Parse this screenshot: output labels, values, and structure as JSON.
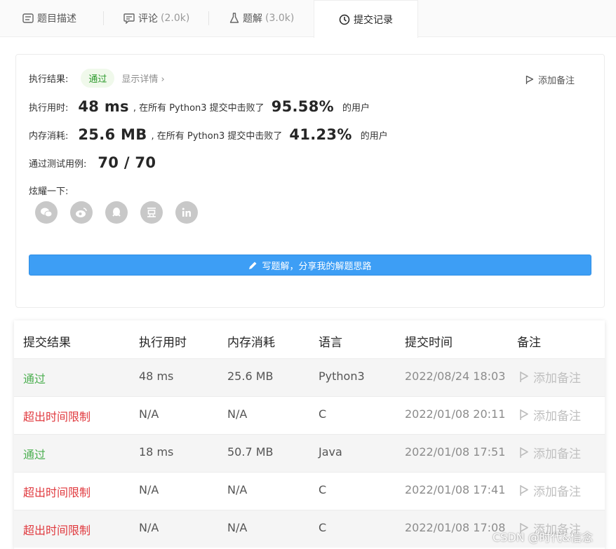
{
  "tabs": [
    {
      "label": "题目描述",
      "count": "",
      "icon": "description-icon"
    },
    {
      "label": "评论",
      "count": "(2.0k)",
      "icon": "comment-icon"
    },
    {
      "label": "题解",
      "count": "(3.0k)",
      "icon": "flask-icon"
    },
    {
      "label": "提交记录",
      "count": "",
      "icon": "clock-icon"
    }
  ],
  "result": {
    "label": "执行结果:",
    "status": "通过",
    "detail": "显示详情 ›",
    "add_note": "添加备注",
    "runtime_label": "执行用时:",
    "runtime_value": "48 ms",
    "runtime_text": ", 在所有 Python3 提交中击败了",
    "runtime_percent": "95.58%",
    "runtime_suffix": "的用户",
    "memory_label": "内存消耗:",
    "memory_value": "25.6 MB",
    "memory_text": ", 在所有 Python3 提交中击败了",
    "memory_percent": "41.23%",
    "memory_suffix": "的用户",
    "tests_label": "通过测试用例:",
    "tests_value": "70 / 70",
    "share_label": "炫耀一下:",
    "share_icons": [
      "wechat-icon",
      "weibo-icon",
      "qq-icon",
      "douban-icon",
      "linkedin-icon"
    ],
    "write_button": "写题解，分享我的解题思路"
  },
  "table": {
    "headers": [
      "提交结果",
      "执行用时",
      "内存消耗",
      "语言",
      "提交时间",
      "备注"
    ],
    "rows": [
      {
        "result": "通过",
        "ok": true,
        "runtime": "48 ms",
        "memory": "25.6 MB",
        "lang": "Python3",
        "time": "2022/08/24 18:03",
        "note": "添加备注"
      },
      {
        "result": "超出时间限制",
        "ok": false,
        "runtime": "N/A",
        "memory": "N/A",
        "lang": "C",
        "time": "2022/01/08 20:11",
        "note": "添加备注"
      },
      {
        "result": "通过",
        "ok": true,
        "runtime": "18 ms",
        "memory": "50.7 MB",
        "lang": "Java",
        "time": "2022/01/08 17:51",
        "note": "添加备注"
      },
      {
        "result": "超出时间限制",
        "ok": false,
        "runtime": "N/A",
        "memory": "N/A",
        "lang": "C",
        "time": "2022/01/08 17:41",
        "note": "添加备注"
      },
      {
        "result": "超出时间限制",
        "ok": false,
        "runtime": "N/A",
        "memory": "N/A",
        "lang": "C",
        "time": "2022/01/08 17:08",
        "note": "添加备注"
      }
    ]
  },
  "watermark": "CSDN @时代&信念",
  "colors": {
    "pass": "#4caf50",
    "fail": "#e0393e",
    "button": "#3d9ef5"
  }
}
